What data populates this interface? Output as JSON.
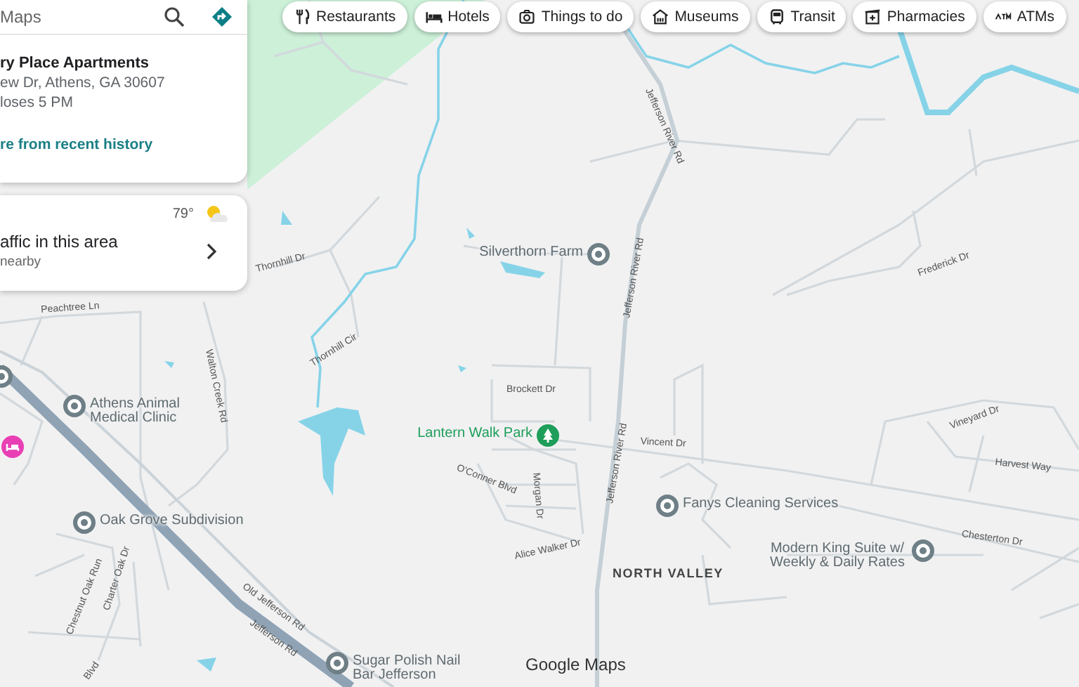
{
  "search": {
    "placeholder": "Maps"
  },
  "place_card": {
    "name": "ry Place Apartments",
    "address": "ew Dr, Athens, GA 30607",
    "hours": "loses 5 PM",
    "link": "re from recent history"
  },
  "traffic_card": {
    "temperature": "79°",
    "title": "affic in this area",
    "subtitle": "nearby"
  },
  "chips": [
    {
      "label": "Restaurants",
      "kind": "restaurant"
    },
    {
      "label": "Hotels",
      "kind": "hotel"
    },
    {
      "label": "Things to do",
      "kind": "camera"
    },
    {
      "label": "Museums",
      "kind": "museum"
    },
    {
      "label": "Transit",
      "kind": "transit"
    },
    {
      "label": "Pharmacies",
      "kind": "pharmacy"
    },
    {
      "label": "ATMs",
      "kind": "atm"
    }
  ],
  "places": [
    {
      "name": "Silverthorn Farm",
      "kind": "pin"
    },
    {
      "name": "Athens Animal Medical Clinic",
      "kind": "pin"
    },
    {
      "name": "Lantern Walk Park",
      "kind": "park"
    },
    {
      "name": "Oak Grove Subdivision",
      "kind": "pin"
    },
    {
      "name": "Fanys Cleaning Services",
      "kind": "pin"
    },
    {
      "name": "Modern King Suite w/ Weekly & Daily Rates",
      "kind": "pin"
    },
    {
      "name": "Sugar Polish Nail Bar Jefferson",
      "kind": "pin"
    },
    {
      "kind": "hotel"
    },
    {
      "kind": "pin"
    }
  ],
  "streets": [
    "Jefferson River Rd",
    "Jefferson River Rd",
    "Jefferson River Rd",
    "Thornhill Dr",
    "Thornhill Cir",
    "Peachtree Ln",
    "Walton Creek Rd",
    "Frederick Dr",
    "Brockett Dr",
    "Vincent Dr",
    "O'Conner Blvd",
    "Morgan Dr",
    "Alice Walker Dr",
    "Vineyard Dr",
    "Harvest Way",
    "Chesterton Dr",
    "Old Jefferson Rd",
    "Jefferson Rd",
    "Chestnut Oak Run",
    "Charter Oak Dr",
    "Blvd"
  ],
  "area_label": "NORTH VALLEY",
  "logo": "Google Maps"
}
